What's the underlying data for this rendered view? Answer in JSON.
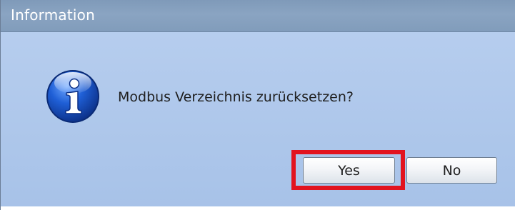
{
  "window": {
    "title": "Information"
  },
  "message": {
    "text": "Modbus Verzeichnis zurücksetzen?",
    "icon": "info-icon"
  },
  "buttons": {
    "yes_label": "Yes",
    "no_label": "No"
  },
  "annotation": {
    "highlight_color": "#e2131f",
    "highlighted_button": "Yes"
  },
  "colors": {
    "titlebar": "#819cbb",
    "dialog_background": "#a9c4e8",
    "title_text": "#ffffff"
  }
}
